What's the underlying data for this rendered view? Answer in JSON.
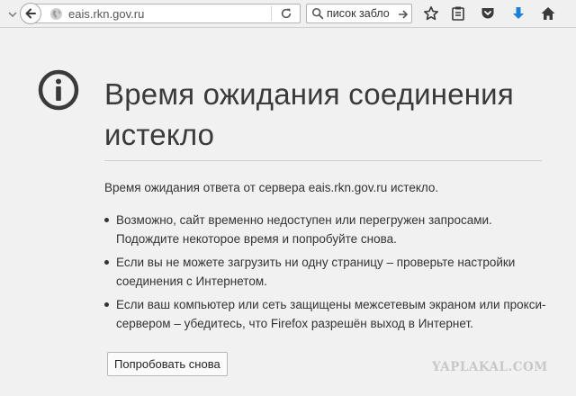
{
  "toolbar": {
    "url": "eais.rkn.gov.ru",
    "search_text": "писок забло",
    "icons": [
      "back-icon",
      "dropmarker-icon",
      "globe-icon",
      "reload-icon",
      "search-icon",
      "go-arrow-icon",
      "star-icon",
      "reading-list-icon",
      "pocket-icon",
      "download-icon",
      "home-icon"
    ],
    "download_color": "#1a7fd6"
  },
  "error": {
    "title": "Время ожидания соединения истекло",
    "description": "Время ожидания ответа от сервера eais.rkn.gov.ru истекло.",
    "bullets": [
      "Возможно, сайт временно недоступен или перегружен запросами. Подождите некоторое время и попробуйте снова.",
      "Если вы не можете загрузить ни одну страницу – проверьте настройки соединения с Интернетом.",
      "Если ваш компьютер или сеть защищены межсетевым экраном или прокси-сервером – убедитесь, что Firefox разрешён выход в Интернет."
    ],
    "retry_label": "Попробовать снова"
  },
  "watermark": "YAPLAKAL.COM"
}
